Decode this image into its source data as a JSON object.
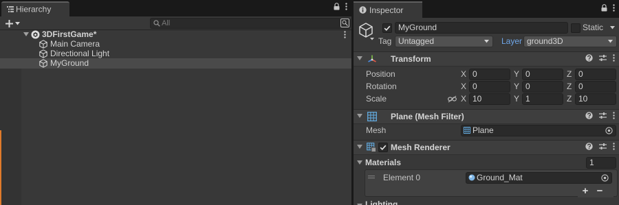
{
  "hierarchy": {
    "tab_label": "Hierarchy",
    "search_placeholder": "All",
    "scene_name": "3DFirstGame*",
    "items": [
      "Main Camera",
      "Directional Light",
      "MyGround"
    ]
  },
  "inspector": {
    "tab_label": "Inspector",
    "object_name": "MyGround",
    "active": true,
    "static_label": "Static",
    "tag_label": "Tag",
    "tag_value": "Untagged",
    "layer_label": "Layer",
    "layer_value": "ground3D",
    "transform": {
      "title": "Transform",
      "position_label": "Position",
      "rotation_label": "Rotation",
      "scale_label": "Scale",
      "axis_x": "X",
      "axis_y": "Y",
      "axis_z": "Z",
      "position": {
        "x": "0",
        "y": "0",
        "z": "0"
      },
      "rotation": {
        "x": "0",
        "y": "0",
        "z": "0"
      },
      "scale": {
        "x": "10",
        "y": "1",
        "z": "10"
      }
    },
    "mesh_filter": {
      "title": "Plane (Mesh Filter)",
      "mesh_label": "Mesh",
      "mesh_value": "Plane"
    },
    "mesh_renderer": {
      "title": "Mesh Renderer",
      "enabled": true,
      "materials_label": "Materials",
      "materials_count": "1",
      "element_label": "Element 0",
      "element_value": "Ground_Mat",
      "add_label": "+",
      "remove_label": "−"
    },
    "lighting_label": "Lighting"
  },
  "colors": {
    "panel_bg": "#383838",
    "window_bg": "#191919",
    "selected_row": "#4a4a4a",
    "field_bg": "#2a2a2a",
    "accent_orange": "#e07a2a"
  }
}
